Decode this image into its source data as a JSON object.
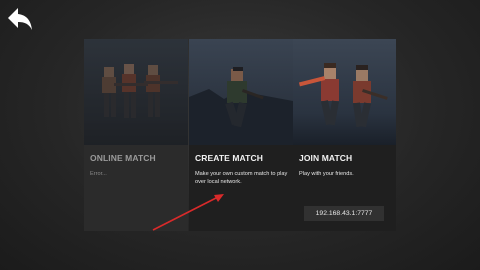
{
  "colors": {
    "accent_arrow": "#d92a2a",
    "card_bg": "#1f1f1f",
    "card_disabled_bg": "#2b2b2b"
  },
  "icons": {
    "back": "back-arrow-icon"
  },
  "cards": {
    "online": {
      "title": "ONLINE MATCH",
      "description": "Error..."
    },
    "create": {
      "title": "CREATE MATCH",
      "description": "Make your own custom match to play over local network."
    },
    "join": {
      "title": "JOIN MATCH",
      "description": "Play with your friends.",
      "address": "192.168.43.1:7777"
    }
  }
}
